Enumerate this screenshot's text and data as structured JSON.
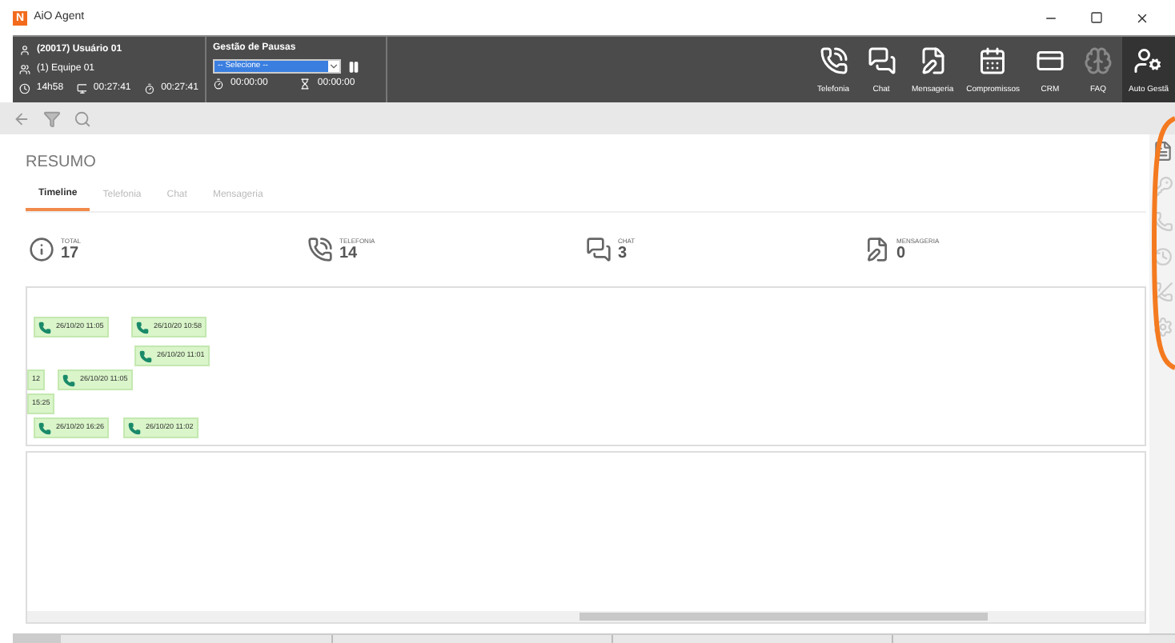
{
  "window": {
    "title": "AiO Agent",
    "logo": "N"
  },
  "agent": {
    "user": "(20017) Usuário 01",
    "team": "(1) Equipe 01",
    "time": "14h58",
    "timer_1": "00:27:41",
    "timer_2": "00:27:41"
  },
  "pauses": {
    "title": "Gestão de Pausas",
    "select_value": "-- Selecione --",
    "timer_1": "00:00:00",
    "timer_2": "00:00:00"
  },
  "toolbar": [
    {
      "label": "Telefonia",
      "kind": "phone",
      "selected": false
    },
    {
      "label": "Chat",
      "kind": "chat",
      "selected": false
    },
    {
      "label": "Mensageria",
      "kind": "message",
      "selected": false
    },
    {
      "label": "Compromissos",
      "kind": "calendar",
      "selected": false
    },
    {
      "label": "CRM",
      "kind": "crm",
      "selected": false
    },
    {
      "label": "FAQ",
      "kind": "faq",
      "selected": false
    },
    {
      "label": "Auto Gestã",
      "kind": "self",
      "selected": true
    }
  ],
  "page": {
    "title": "RESUMO"
  },
  "tabs": [
    {
      "label": "Timeline",
      "selected": true
    },
    {
      "label": "Telefonia",
      "selected": false
    },
    {
      "label": "Chat",
      "selected": false
    },
    {
      "label": "Mensageria",
      "selected": false
    }
  ],
  "stats": [
    {
      "kind": "total",
      "label": "TOTAL",
      "value": "17"
    },
    {
      "kind": "phone",
      "label": "TELEFONIA",
      "value": "14"
    },
    {
      "kind": "chat",
      "label": "CHAT",
      "value": "3"
    },
    {
      "kind": "message",
      "label": "MENSAGERIA",
      "value": "0"
    }
  ],
  "timeline": [
    {
      "text": "26/10/20 11:05",
      "icon": true
    },
    {
      "text": "26/10/20 10:58",
      "icon": true
    },
    {
      "text": "26/10/20 11:01",
      "icon": true
    },
    {
      "text": "12",
      "icon": false
    },
    {
      "text": "26/10/20 11:05",
      "icon": true
    },
    {
      "text": "15:25",
      "icon": false
    },
    {
      "text": "26/10/20 16:26",
      "icon": true
    },
    {
      "text": "26/10/20 11:02",
      "icon": true
    }
  ],
  "side_tools": [
    {
      "kind": "document",
      "disabled": false
    },
    {
      "kind": "transfer",
      "disabled": true
    },
    {
      "kind": "hold",
      "disabled": true
    },
    {
      "kind": "history",
      "disabled": true
    },
    {
      "kind": "hangup",
      "disabled": true
    },
    {
      "kind": "settings",
      "disabled": true
    }
  ]
}
